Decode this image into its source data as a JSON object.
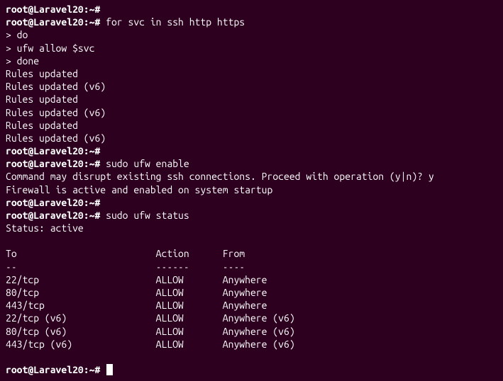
{
  "prompt_text": "root@Laravel20:~#",
  "lines": {
    "cmd1": " for svc in ssh http https",
    "cont1": "> do",
    "cont2": "> ufw allow $svc",
    "cont3": "> done",
    "out1": "Rules updated",
    "out2": "Rules updated (v6)",
    "out3": "Rules updated",
    "out4": "Rules updated (v6)",
    "out5": "Rules updated",
    "out6": "Rules updated (v6)",
    "cmd2": " sudo ufw enable",
    "warn1": "Command may disrupt existing ssh connections. Proceed with operation (y|n)? y",
    "fw1": "Firewall is active and enabled on system startup",
    "cmd3": " sudo ufw status",
    "status1": "Status: active",
    "table_header": "To                         Action      From",
    "table_divider": "--                         ------      ----",
    "row1": "22/tcp                     ALLOW       Anywhere",
    "row2": "80/tcp                     ALLOW       Anywhere",
    "row3": "443/tcp                    ALLOW       Anywhere",
    "row4": "22/tcp (v6)                ALLOW       Anywhere (v6)",
    "row5": "80/tcp (v6)                ALLOW       Anywhere (v6)",
    "row6": "443/tcp (v6)               ALLOW       Anywhere (v6)"
  },
  "chart_data": {
    "type": "table",
    "title": "UFW Firewall Status",
    "status": "active",
    "columns": [
      "To",
      "Action",
      "From"
    ],
    "rows": [
      {
        "to": "22/tcp",
        "action": "ALLOW",
        "from": "Anywhere"
      },
      {
        "to": "80/tcp",
        "action": "ALLOW",
        "from": "Anywhere"
      },
      {
        "to": "443/tcp",
        "action": "ALLOW",
        "from": "Anywhere"
      },
      {
        "to": "22/tcp (v6)",
        "action": "ALLOW",
        "from": "Anywhere (v6)"
      },
      {
        "to": "80/tcp (v6)",
        "action": "ALLOW",
        "from": "Anywhere (v6)"
      },
      {
        "to": "443/tcp (v6)",
        "action": "ALLOW",
        "from": "Anywhere (v6)"
      }
    ]
  }
}
